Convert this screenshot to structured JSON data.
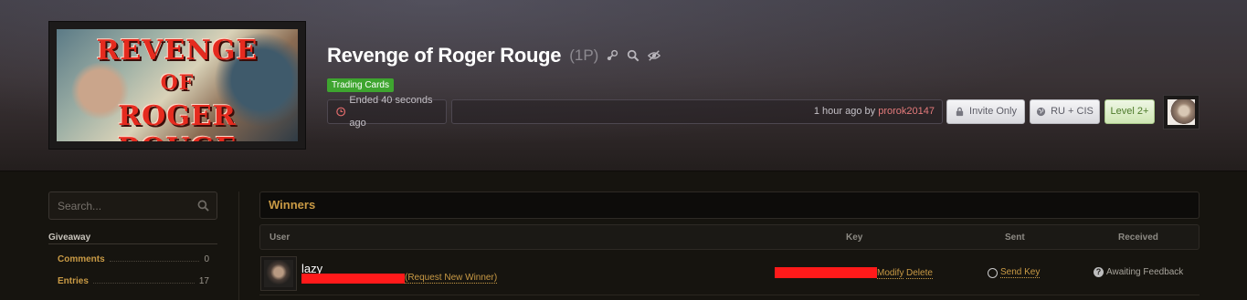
{
  "giveaway": {
    "image_text": [
      "REVENGE",
      "OF",
      "ROGER ROUGE"
    ],
    "title": "Revenge of Roger Rouge",
    "copies": "(1P)",
    "title_icons": [
      "steam-icon",
      "search-icon",
      "hide-icon"
    ],
    "tag": "Trading Cards",
    "ended": "Ended 40 seconds ago",
    "created_ago": "1 hour ago by ",
    "creator": "prorok20147",
    "buttons": {
      "invite_only": "Invite Only",
      "region": "RU + CIS",
      "level": "Level 2+"
    }
  },
  "sidebar": {
    "search_placeholder": "Search...",
    "section": "Giveaway",
    "items": [
      {
        "label": "Comments",
        "count": "0"
      },
      {
        "label": "Entries",
        "count": "17"
      }
    ]
  },
  "winners": {
    "heading": "Winners",
    "columns": {
      "user": "User",
      "key": "Key",
      "sent": "Sent",
      "received": "Received"
    },
    "row": {
      "username": "lazy",
      "request_new": "(Request New Winner)",
      "modify": "Modify",
      "delete": "Delete",
      "send_key": "Send Key",
      "received_status": "Awaiting Feedback"
    }
  },
  "colors": {
    "accent": "#c99a45",
    "tag_green": "#3ea52f",
    "creator_link": "#e57b7b",
    "redaction": "#ff1a1a"
  }
}
